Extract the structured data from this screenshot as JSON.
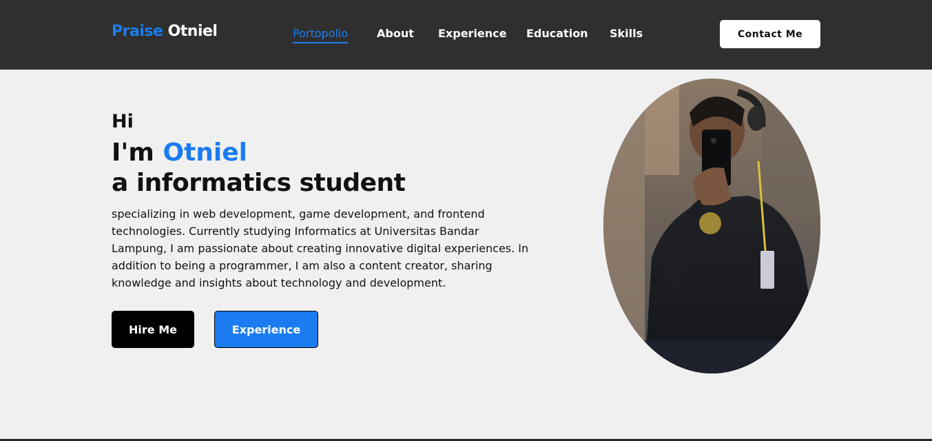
{
  "header": {
    "brand_first": "Praise",
    "brand_last": "Otniel",
    "nav": [
      {
        "label": "Portopolio",
        "active": true
      },
      {
        "label": "About",
        "active": false
      },
      {
        "label": "Experience",
        "active": false
      },
      {
        "label": "Education",
        "active": false
      },
      {
        "label": "Skills",
        "active": false
      }
    ],
    "contact_label": "Contact Me"
  },
  "hero": {
    "greeting": "Hi",
    "im_prefix": "I'm",
    "name": "Otniel",
    "role": "a informatics student",
    "description": "specializing in web development, game development, and frontend technologies. Currently studying Informatics at Universitas Bandar Lampung, I am passionate about creating innovative digital experiences. In addition to being a programmer, I am also a content creator, sharing knowledge and insights about technology and development.",
    "hire_label": "Hire Me",
    "experience_label": "Experience"
  },
  "colors": {
    "accent": "#1a7cf0",
    "header_bg": "#2f2f2f",
    "page_bg": "#f0f0f0"
  },
  "icons": {
    "profile_photo": "profile-photo"
  }
}
